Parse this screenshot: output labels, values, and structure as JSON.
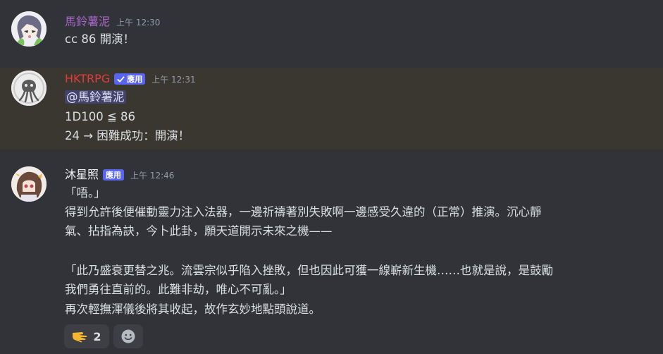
{
  "colors": {
    "background": "#313338",
    "highlight_background": "#3a3630",
    "bot_badge": "#5865f2",
    "text": "#dbdee1",
    "timestamp": "#949ba4"
  },
  "messages": [
    {
      "username": "馬鈴薯泥",
      "username_color": "#a766c9",
      "timestamp": "上午 12:30",
      "lines": [
        "cc 86 開演！"
      ]
    },
    {
      "username": "HKTRPG",
      "username_color": "#e23c3c",
      "badge": "應用",
      "timestamp": "上午 12:31",
      "mention": "@馬鈴薯泥",
      "lines": [
        "1D100 ≦ 86",
        "24 → 困難成功：開演！"
      ]
    },
    {
      "username": "沐星照",
      "username_color": "#f2f3f5",
      "badge": "應用",
      "timestamp": "上午 12:46",
      "lines": [
        "「唔。」",
        "得到允許後便催動靈力注入法器，一邊祈禱著別失敗啊一邊感受久違的（正常）推演。沉心靜",
        "氣、拈指為訣，今卜此卦，願天道開示未來之機——",
        "「此乃盛衰更替之兆。流雲宗似乎陷入挫敗，但也因此可獲一線嶄新生機……也就是說，是鼓勵",
        "我們勇往直前的。此難非劫，唯心不可亂。」",
        "再次輕撫渾儀後將其收起，故作玄妙地點頭說道。"
      ],
      "reactions": [
        {
          "icon": "pointing-hand-icon",
          "count": "2"
        },
        {
          "icon": "add-reaction-icon"
        }
      ]
    }
  ]
}
